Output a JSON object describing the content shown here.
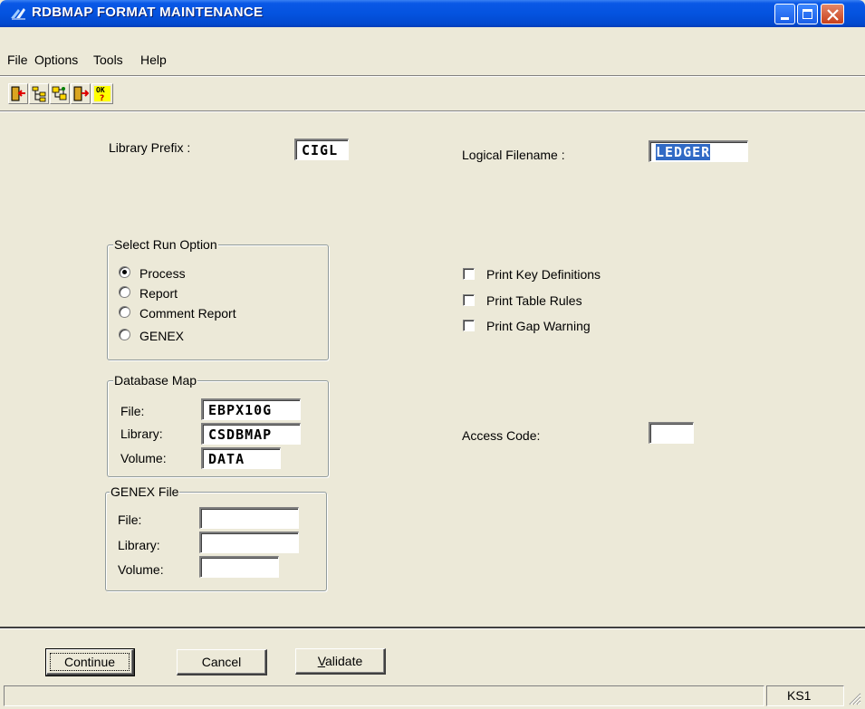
{
  "window": {
    "title": "RDBMAP FORMAT MAINTENANCE",
    "titlebar_color": "#0453DF"
  },
  "menu": [
    "File",
    "Options",
    "Tools",
    "Help"
  ],
  "toolbar": {
    "icons": [
      "exit-left-icon",
      "tree-icon",
      "flowchart-icon",
      "exit-right-icon",
      "ok-question-icon"
    ]
  },
  "form": {
    "library_prefix_label": "Library Prefix  :",
    "library_prefix_value": "CIGL",
    "logical_filename_label": "Logical Filename :",
    "logical_filename_value": "LEDGER",
    "run_option": {
      "title": "Select Run Option",
      "options": [
        "Process",
        "Report",
        "Comment Report",
        "GENEX"
      ],
      "selected": "Process"
    },
    "checkboxes": [
      "Print Key Definitions",
      "Print Table Rules",
      "Print Gap Warning"
    ],
    "database_map": {
      "title": "Database Map",
      "file_label": "File:",
      "file_value": "EBPX10G",
      "library_label": "Library:",
      "library_value": "CSDBMAP",
      "volume_label": "Volume:",
      "volume_value": "DATA"
    },
    "access_code_label": "Access Code:",
    "access_code_value": "",
    "genex_file": {
      "title": "GENEX File",
      "file_label": "File:",
      "library_label": "Library:",
      "volume_label": "Volume:",
      "file_value": "",
      "library_value": "",
      "volume_value": ""
    }
  },
  "buttons": {
    "continue": "Continue",
    "cancel": "Cancel",
    "validate": "Validate"
  },
  "status": {
    "right_text": "KS1"
  }
}
